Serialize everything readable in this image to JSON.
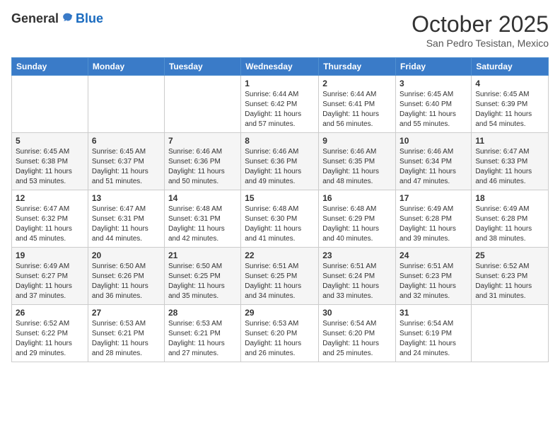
{
  "header": {
    "logo_general": "General",
    "logo_blue": "Blue",
    "month_title": "October 2025",
    "subtitle": "San Pedro Tesistan, Mexico"
  },
  "days_of_week": [
    "Sunday",
    "Monday",
    "Tuesday",
    "Wednesday",
    "Thursday",
    "Friday",
    "Saturday"
  ],
  "weeks": [
    [
      {
        "day": "",
        "sunrise": "",
        "sunset": "",
        "daylight": ""
      },
      {
        "day": "",
        "sunrise": "",
        "sunset": "",
        "daylight": ""
      },
      {
        "day": "",
        "sunrise": "",
        "sunset": "",
        "daylight": ""
      },
      {
        "day": "1",
        "sunrise": "Sunrise: 6:44 AM",
        "sunset": "Sunset: 6:42 PM",
        "daylight": "Daylight: 11 hours and 57 minutes."
      },
      {
        "day": "2",
        "sunrise": "Sunrise: 6:44 AM",
        "sunset": "Sunset: 6:41 PM",
        "daylight": "Daylight: 11 hours and 56 minutes."
      },
      {
        "day": "3",
        "sunrise": "Sunrise: 6:45 AM",
        "sunset": "Sunset: 6:40 PM",
        "daylight": "Daylight: 11 hours and 55 minutes."
      },
      {
        "day": "4",
        "sunrise": "Sunrise: 6:45 AM",
        "sunset": "Sunset: 6:39 PM",
        "daylight": "Daylight: 11 hours and 54 minutes."
      }
    ],
    [
      {
        "day": "5",
        "sunrise": "Sunrise: 6:45 AM",
        "sunset": "Sunset: 6:38 PM",
        "daylight": "Daylight: 11 hours and 53 minutes."
      },
      {
        "day": "6",
        "sunrise": "Sunrise: 6:45 AM",
        "sunset": "Sunset: 6:37 PM",
        "daylight": "Daylight: 11 hours and 51 minutes."
      },
      {
        "day": "7",
        "sunrise": "Sunrise: 6:46 AM",
        "sunset": "Sunset: 6:36 PM",
        "daylight": "Daylight: 11 hours and 50 minutes."
      },
      {
        "day": "8",
        "sunrise": "Sunrise: 6:46 AM",
        "sunset": "Sunset: 6:36 PM",
        "daylight": "Daylight: 11 hours and 49 minutes."
      },
      {
        "day": "9",
        "sunrise": "Sunrise: 6:46 AM",
        "sunset": "Sunset: 6:35 PM",
        "daylight": "Daylight: 11 hours and 48 minutes."
      },
      {
        "day": "10",
        "sunrise": "Sunrise: 6:46 AM",
        "sunset": "Sunset: 6:34 PM",
        "daylight": "Daylight: 11 hours and 47 minutes."
      },
      {
        "day": "11",
        "sunrise": "Sunrise: 6:47 AM",
        "sunset": "Sunset: 6:33 PM",
        "daylight": "Daylight: 11 hours and 46 minutes."
      }
    ],
    [
      {
        "day": "12",
        "sunrise": "Sunrise: 6:47 AM",
        "sunset": "Sunset: 6:32 PM",
        "daylight": "Daylight: 11 hours and 45 minutes."
      },
      {
        "day": "13",
        "sunrise": "Sunrise: 6:47 AM",
        "sunset": "Sunset: 6:31 PM",
        "daylight": "Daylight: 11 hours and 44 minutes."
      },
      {
        "day": "14",
        "sunrise": "Sunrise: 6:48 AM",
        "sunset": "Sunset: 6:31 PM",
        "daylight": "Daylight: 11 hours and 42 minutes."
      },
      {
        "day": "15",
        "sunrise": "Sunrise: 6:48 AM",
        "sunset": "Sunset: 6:30 PM",
        "daylight": "Daylight: 11 hours and 41 minutes."
      },
      {
        "day": "16",
        "sunrise": "Sunrise: 6:48 AM",
        "sunset": "Sunset: 6:29 PM",
        "daylight": "Daylight: 11 hours and 40 minutes."
      },
      {
        "day": "17",
        "sunrise": "Sunrise: 6:49 AM",
        "sunset": "Sunset: 6:28 PM",
        "daylight": "Daylight: 11 hours and 39 minutes."
      },
      {
        "day": "18",
        "sunrise": "Sunrise: 6:49 AM",
        "sunset": "Sunset: 6:28 PM",
        "daylight": "Daylight: 11 hours and 38 minutes."
      }
    ],
    [
      {
        "day": "19",
        "sunrise": "Sunrise: 6:49 AM",
        "sunset": "Sunset: 6:27 PM",
        "daylight": "Daylight: 11 hours and 37 minutes."
      },
      {
        "day": "20",
        "sunrise": "Sunrise: 6:50 AM",
        "sunset": "Sunset: 6:26 PM",
        "daylight": "Daylight: 11 hours and 36 minutes."
      },
      {
        "day": "21",
        "sunrise": "Sunrise: 6:50 AM",
        "sunset": "Sunset: 6:25 PM",
        "daylight": "Daylight: 11 hours and 35 minutes."
      },
      {
        "day": "22",
        "sunrise": "Sunrise: 6:51 AM",
        "sunset": "Sunset: 6:25 PM",
        "daylight": "Daylight: 11 hours and 34 minutes."
      },
      {
        "day": "23",
        "sunrise": "Sunrise: 6:51 AM",
        "sunset": "Sunset: 6:24 PM",
        "daylight": "Daylight: 11 hours and 33 minutes."
      },
      {
        "day": "24",
        "sunrise": "Sunrise: 6:51 AM",
        "sunset": "Sunset: 6:23 PM",
        "daylight": "Daylight: 11 hours and 32 minutes."
      },
      {
        "day": "25",
        "sunrise": "Sunrise: 6:52 AM",
        "sunset": "Sunset: 6:23 PM",
        "daylight": "Daylight: 11 hours and 31 minutes."
      }
    ],
    [
      {
        "day": "26",
        "sunrise": "Sunrise: 6:52 AM",
        "sunset": "Sunset: 6:22 PM",
        "daylight": "Daylight: 11 hours and 29 minutes."
      },
      {
        "day": "27",
        "sunrise": "Sunrise: 6:53 AM",
        "sunset": "Sunset: 6:21 PM",
        "daylight": "Daylight: 11 hours and 28 minutes."
      },
      {
        "day": "28",
        "sunrise": "Sunrise: 6:53 AM",
        "sunset": "Sunset: 6:21 PM",
        "daylight": "Daylight: 11 hours and 27 minutes."
      },
      {
        "day": "29",
        "sunrise": "Sunrise: 6:53 AM",
        "sunset": "Sunset: 6:20 PM",
        "daylight": "Daylight: 11 hours and 26 minutes."
      },
      {
        "day": "30",
        "sunrise": "Sunrise: 6:54 AM",
        "sunset": "Sunset: 6:20 PM",
        "daylight": "Daylight: 11 hours and 25 minutes."
      },
      {
        "day": "31",
        "sunrise": "Sunrise: 6:54 AM",
        "sunset": "Sunset: 6:19 PM",
        "daylight": "Daylight: 11 hours and 24 minutes."
      },
      {
        "day": "",
        "sunrise": "",
        "sunset": "",
        "daylight": ""
      }
    ]
  ]
}
